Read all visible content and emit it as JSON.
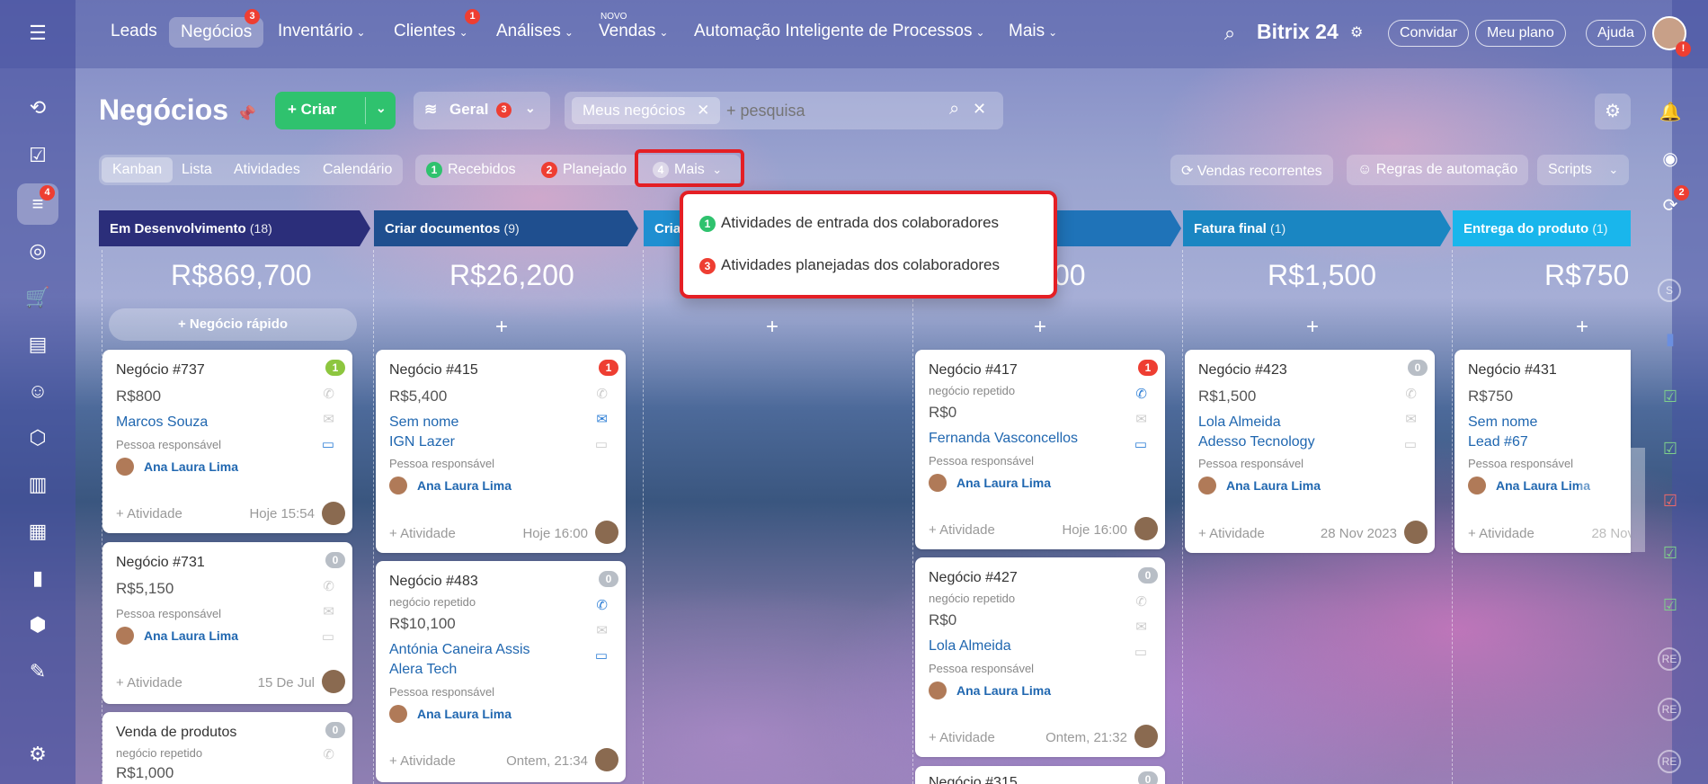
{
  "topnav": {
    "items": [
      {
        "label": "Leads",
        "badge": ""
      },
      {
        "label": "Negócios",
        "badge": "3"
      },
      {
        "label": "Inventário",
        "badge": ""
      },
      {
        "label": "Clientes",
        "badge": "1"
      },
      {
        "label": "Análises",
        "badge": ""
      },
      {
        "label": "Vendas",
        "badge": "",
        "tag": "NOVO"
      },
      {
        "label": "Automação Inteligente de Processos",
        "badge": ""
      },
      {
        "label": "Mais",
        "badge": ""
      }
    ],
    "brand": "Bitrix 24",
    "invite": "Convidar",
    "plan": "Meu plano",
    "help": "Ajuda",
    "sidebar_badge": "4",
    "right_badge": "2"
  },
  "header": {
    "title": "Negócios",
    "create_label": "Criar",
    "geral_label": "Geral",
    "geral_badge": "3",
    "filter_chip": "Meus negócios",
    "search_placeholder": "+ pesquisa"
  },
  "viewtabs": [
    "Kanban",
    "Lista",
    "Atividades",
    "Calendário"
  ],
  "counters": {
    "received": {
      "count": "1",
      "label": "Recebidos"
    },
    "planned": {
      "count": "2",
      "label": "Planejado"
    },
    "more": {
      "count": "4",
      "label": "Mais"
    }
  },
  "right_buttons": {
    "recurring": "Vendas recorrentes",
    "automation": "Regras de automação",
    "scripts": "Scripts"
  },
  "dropdown": {
    "items": [
      {
        "count": "1",
        "label": "Atividades de entrada dos colaboradores"
      },
      {
        "count": "3",
        "label": "Atividades planejadas dos colaboradores"
      }
    ]
  },
  "columns": [
    {
      "title": "Em Desenvolvimento",
      "count": "(18)",
      "total": "R$869,700",
      "color": "#2b2e7a"
    },
    {
      "title": "Criar documentos",
      "count": "(9)",
      "total": "R$26,200",
      "color": "#1f4f8f"
    },
    {
      "title": "Cria",
      "count": "",
      "total": "",
      "color": "#1f8fd1"
    },
    {
      "title": "",
      "count": "",
      "total": "00",
      "color": "#1f73b8"
    },
    {
      "title": "Fatura final",
      "count": "(1)",
      "total": "R$1,500",
      "color": "#1a86c2"
    },
    {
      "title": "Entrega do produto",
      "count": "(1)",
      "total": "R$750",
      "color": "#19b6ec"
    }
  ],
  "quick_deal": "Negócio rápido",
  "common": {
    "responsible_label": "Pessoa responsável",
    "activity": "+ Atividade",
    "repeat": "negócio repetido",
    "person": "Ana Laura Lima"
  },
  "cards": {
    "c737": {
      "title": "Negócio #737",
      "badge": "1",
      "price": "R$800",
      "contact": "Marcos Souza",
      "date": "Hoje 15:54"
    },
    "c731": {
      "title": "Negócio #731",
      "badge": "0",
      "price": "R$5,150",
      "date": "15 De Jul"
    },
    "cvp": {
      "title": "Venda de produtos",
      "badge": "0",
      "price": "R$1,000"
    },
    "c415": {
      "title": "Negócio #415",
      "badge": "1",
      "price": "R$5,400",
      "contact": "Sem nome",
      "company": "IGN Lazer",
      "date": "Hoje 16:00"
    },
    "c483": {
      "title": "Negócio #483",
      "badge": "0",
      "price": "R$10,100",
      "contact": "Antónia Caneira Assis",
      "company": "Alera Tech",
      "date": "Ontem, 21:34"
    },
    "c417": {
      "title": "Negócio #417",
      "badge": "1",
      "price": "R$0",
      "contact": "Fernanda Vasconcellos",
      "date": "Hoje 16:00"
    },
    "c427": {
      "title": "Negócio #427",
      "badge": "0",
      "price": "R$0",
      "contact": "Lola Almeida",
      "date": "Ontem, 21:32"
    },
    "c415b": {
      "title": "Negócio #315",
      "badge": "0"
    },
    "c423": {
      "title": "Negócio #423",
      "badge": "0",
      "price": "R$1,500",
      "contact": "Lola Almeida",
      "company": "Adesso Tecnology",
      "date": "28 Nov 2023"
    },
    "c431": {
      "title": "Negócio #431",
      "badge": "0",
      "price": "R$750",
      "contact": "Sem nome",
      "company": "Lead #67",
      "date": "28 Nov"
    }
  },
  "right_avatars": [
    "S",
    "RE",
    "RE",
    "RE"
  ],
  "colors": {
    "accent_green": "#2fc26e",
    "badge_red": "#ee3e32",
    "link_blue": "#2067b0",
    "highlight_red": "#e41f25"
  }
}
